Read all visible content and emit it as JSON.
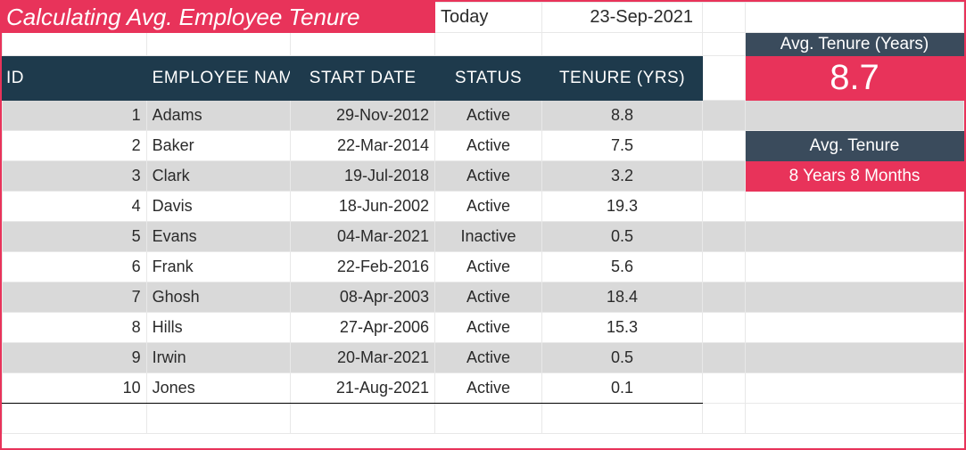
{
  "title": "Calculating Avg. Employee Tenure",
  "today_label": "Today",
  "today_value": "23-Sep-2021",
  "headers": {
    "id": "ID",
    "name": "EMPLOYEE NAME",
    "start": "START DATE",
    "status": "STATUS",
    "tenure": "TENURE (YRS)"
  },
  "rows": [
    {
      "id": "1",
      "name": "Adams",
      "start": "29-Nov-2012",
      "status": "Active",
      "tenure": "8.8"
    },
    {
      "id": "2",
      "name": "Baker",
      "start": "22-Mar-2014",
      "status": "Active",
      "tenure": "7.5"
    },
    {
      "id": "3",
      "name": "Clark",
      "start": "19-Jul-2018",
      "status": "Active",
      "tenure": "3.2"
    },
    {
      "id": "4",
      "name": "Davis",
      "start": "18-Jun-2002",
      "status": "Active",
      "tenure": "19.3"
    },
    {
      "id": "5",
      "name": "Evans",
      "start": "04-Mar-2021",
      "status": "Inactive",
      "tenure": "0.5"
    },
    {
      "id": "6",
      "name": "Frank",
      "start": "22-Feb-2016",
      "status": "Active",
      "tenure": "5.6"
    },
    {
      "id": "7",
      "name": "Ghosh",
      "start": "08-Apr-2003",
      "status": "Active",
      "tenure": "18.4"
    },
    {
      "id": "8",
      "name": "Hills",
      "start": "27-Apr-2006",
      "status": "Active",
      "tenure": "15.3"
    },
    {
      "id": "9",
      "name": "Irwin",
      "start": "20-Mar-2021",
      "status": "Active",
      "tenure": "0.5"
    },
    {
      "id": "10",
      "name": "Jones",
      "start": "21-Aug-2021",
      "status": "Active",
      "tenure": "0.1"
    }
  ],
  "side": {
    "years_label": "Avg. Tenure (Years)",
    "years_value": "8.7",
    "text_label": "Avg. Tenure",
    "text_value": "8 Years 8 Months"
  }
}
